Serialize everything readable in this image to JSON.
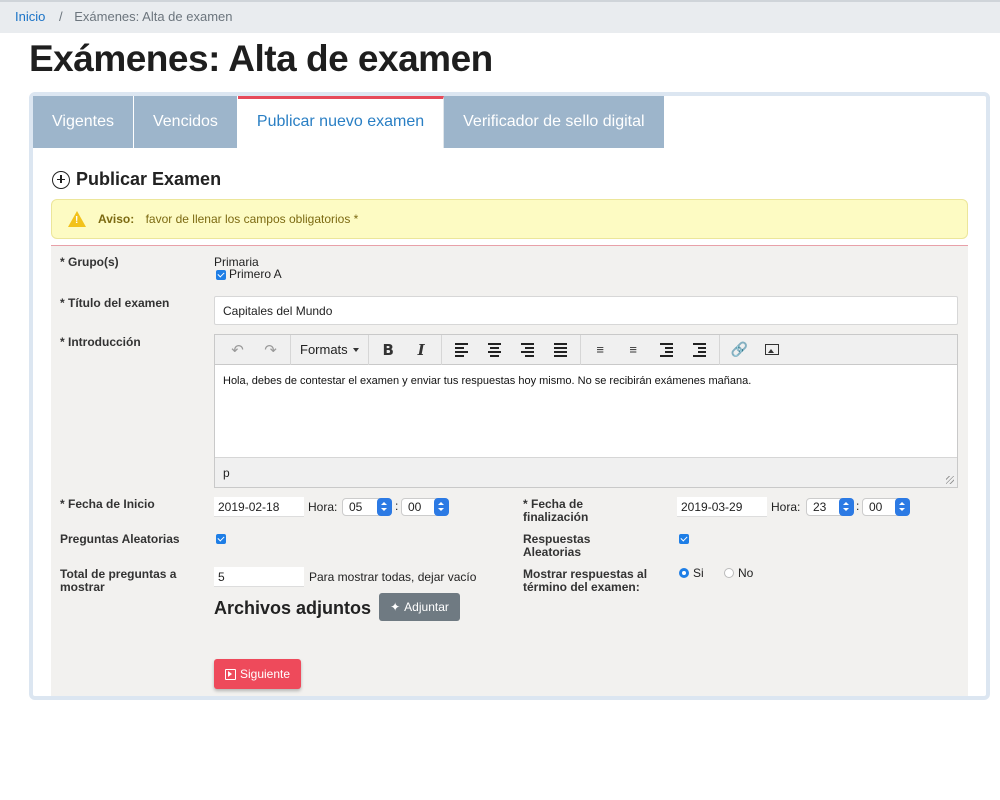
{
  "breadcrumb": {
    "home": "Inicio",
    "separator": "/",
    "current": "Exámenes: Alta de examen"
  },
  "page_title": "Exámenes: Alta de examen",
  "tabs": [
    {
      "label": "Vigentes",
      "active": false
    },
    {
      "label": "Vencidos",
      "active": false
    },
    {
      "label": "Publicar nuevo examen",
      "active": true
    },
    {
      "label": "Verificador de sello digital",
      "active": false
    }
  ],
  "section_title": "Publicar Examen",
  "alert": {
    "title": "Aviso:",
    "message": "favor de llenar los campos obligatorios *",
    "icon": "warning-icon"
  },
  "form": {
    "groups": {
      "label": "* Grupo(s)",
      "parent": "Primaria",
      "child": "Primero A",
      "child_checked": true
    },
    "title": {
      "label": "* Título del examen",
      "value": "Capitales del Mundo"
    },
    "intro": {
      "label": "* Introducción",
      "toolbar": {
        "formats": "Formats"
      },
      "content": "Hola, debes de contestar el examen y enviar tus respuestas hoy mismo. No se recibirán exámenes mañana.",
      "status_path": "p"
    },
    "start": {
      "label": "* Fecha de Inicio",
      "date": "2019-02-18",
      "hora_label": "Hora:",
      "hour": "05",
      "colon": ":",
      "minute": "00"
    },
    "end": {
      "label": "* Fecha de finalización",
      "date": "2019-03-29",
      "hora_label": "Hora:",
      "hour": "23",
      "colon": ":",
      "minute": "00"
    },
    "random_questions": {
      "label": "Preguntas Aleatorias",
      "checked": true
    },
    "random_answers": {
      "label": "Respuestas Aleatorias",
      "checked": true
    },
    "total_questions": {
      "label": "Total de preguntas a mostrar",
      "value": "5",
      "hint": "Para mostrar todas, dejar vacío"
    },
    "show_answers": {
      "label": "Mostrar respuestas al término del examen:",
      "options": [
        "Si",
        "No"
      ],
      "selected": "Si"
    },
    "attachments": {
      "title": "Archivos adjuntos",
      "button": "Adjuntar"
    },
    "next_button": "Siguiente"
  },
  "colors": {
    "accent": "#1e7ee6",
    "tab_inactive": "#9db5cb",
    "danger": "#ee4a5b",
    "alert_bg": "#fdfbc3"
  }
}
